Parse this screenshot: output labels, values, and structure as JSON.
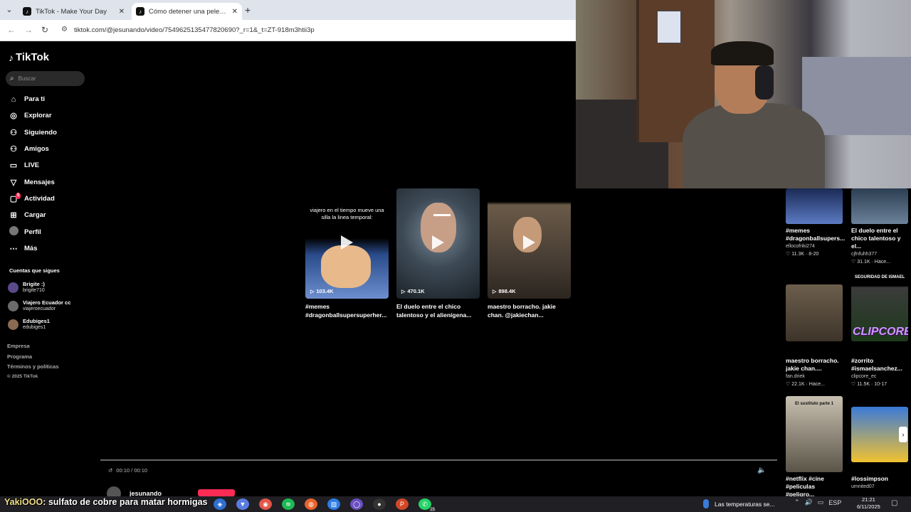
{
  "browser": {
    "tabs": [
      {
        "title": "TikTok - Make Your Day",
        "active": false
      },
      {
        "title": "Cómo detener una pelea como",
        "active": true
      }
    ],
    "url": "tiktok.com/@jesunando/video/7549625135477820690?_r=1&_t=ZT-918m3htii3p"
  },
  "sidebar": {
    "logo": "TikTok",
    "search_placeholder": "Buscar",
    "nav": [
      {
        "label": "Para ti",
        "icon": "home-icon",
        "glyph": "⌂"
      },
      {
        "label": "Explorar",
        "icon": "compass-icon",
        "glyph": "◎"
      },
      {
        "label": "Siguiendo",
        "icon": "following-icon",
        "glyph": "⚇"
      },
      {
        "label": "Amigos",
        "icon": "friends-icon",
        "glyph": "⚇"
      },
      {
        "label": "LIVE",
        "icon": "live-icon",
        "glyph": "▭"
      },
      {
        "label": "Mensajes",
        "icon": "messages-icon",
        "glyph": "▽"
      },
      {
        "label": "Actividad",
        "icon": "activity-icon",
        "glyph": "▢",
        "badge": "5"
      },
      {
        "label": "Cargar",
        "icon": "upload-icon",
        "glyph": "⊞"
      },
      {
        "label": "Perfil",
        "icon": "profile-avatar",
        "glyph": ""
      },
      {
        "label": "Más",
        "icon": "more-icon",
        "glyph": "⋯"
      }
    ],
    "following_title": "Cuentas que sigues",
    "following": [
      {
        "name": "Brigite :)",
        "user": "brigite710"
      },
      {
        "name": "Viajero Ecuador cc",
        "user": "viajeroecuador"
      },
      {
        "name": "Edubiges1",
        "user": "edubiges1"
      }
    ],
    "footer": [
      "Empresa",
      "Programa",
      "Términos y políticas"
    ],
    "copyright": "© 2025 TikTok"
  },
  "grid": [
    {
      "caption": "viajero en el tiempo mueve una silla la linea temporal:",
      "views": "103.4K",
      "title": "#memes #dragonballsupersuperher..."
    },
    {
      "caption": "",
      "views": "470.1K",
      "title": "El duelo entre el chico talentoso y el alienígena..."
    },
    {
      "caption": "",
      "views": "898.4K",
      "title": "maestro borracho. jakie chan. @jakiechan..."
    }
  ],
  "player": {
    "time": "00:10 / 00:10",
    "author": "jesunando"
  },
  "recommended": [
    {
      "title": "#memes #dragonballsupers...",
      "author": "ellocofriki274",
      "likes": "11.3K",
      "date": "8-20",
      "caption": ""
    },
    {
      "title": "El duelo entre el chico talentoso y el...",
      "author": "cjfnfuhh377",
      "likes": "31.1K",
      "date": "Hace...",
      "caption": ""
    },
    {
      "title": "maestro borracho. jakie chan....",
      "author": "fan.driek",
      "likes": "22.1K",
      "date": "Hace...",
      "caption": ""
    },
    {
      "title": "#zorrito #ismaelsanchez...",
      "author": "clipcore_ec",
      "likes": "11.5K",
      "date": "10-17",
      "caption": "SEGURIDAD DE ISMAEL",
      "overlay": "CLIPCORE"
    },
    {
      "title": "#netflix #cine #peliculas #peligro...",
      "author": "",
      "likes": "",
      "date": "",
      "caption": "El sustituto parte 1"
    },
    {
      "title": "#lossimpson",
      "author": "umnited07",
      "likes": "",
      "date": "",
      "caption": ""
    }
  ],
  "taskbar": {
    "ticker_user": "YakiOOO",
    "ticker_text": ": sulfato de cobre para matar hormigas",
    "news": "Las temperaturas se...",
    "lang": "ESP",
    "time": "21:21",
    "date": "6/11/2025",
    "apps": [
      {
        "name": "vscode-icon",
        "color": "#2f6fd1",
        "glyph": "◈"
      },
      {
        "name": "vpn-icon",
        "color": "#5a7be0",
        "glyph": "▼"
      },
      {
        "name": "browser-icon",
        "color": "#e2554a",
        "glyph": "◉"
      },
      {
        "name": "spotify-icon",
        "color": "#1db954",
        "glyph": "≋"
      },
      {
        "name": "firefox-icon",
        "color": "#e8642c",
        "glyph": "◍"
      },
      {
        "name": "paint-icon",
        "color": "#2c7be5",
        "glyph": "▨"
      },
      {
        "name": "obs-icon",
        "color": "#6a4fbf",
        "glyph": "◯"
      },
      {
        "name": "github-icon",
        "color": "#333",
        "glyph": "●"
      },
      {
        "name": "powerpoint-icon",
        "color": "#d24726",
        "glyph": "P"
      },
      {
        "name": "whatsapp-icon",
        "color": "#25d366",
        "glyph": "✆",
        "count": "25"
      }
    ]
  }
}
